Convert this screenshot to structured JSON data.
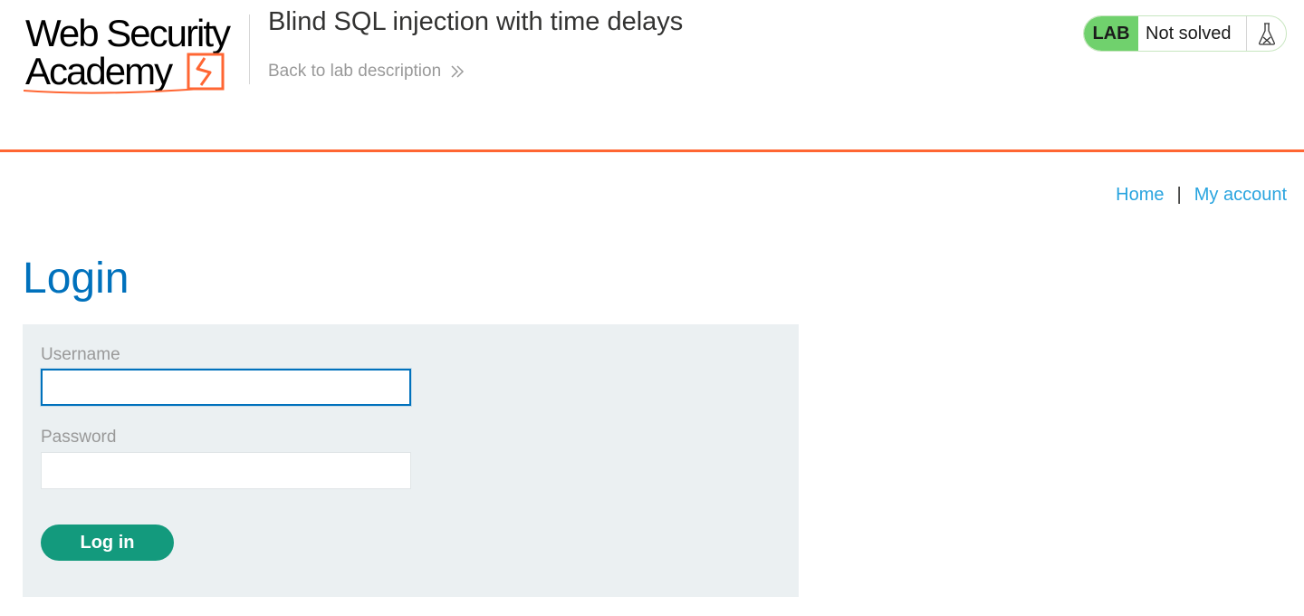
{
  "header": {
    "logo_line1": "Web Security",
    "logo_line2": "Academy",
    "lab_title": "Blind SQL injection with time delays",
    "back_link": "Back to lab description",
    "status": {
      "badge": "LAB",
      "text": "Not solved",
      "icon": "flask-icon"
    }
  },
  "nav": {
    "home": "Home",
    "separator": "|",
    "account": "My account"
  },
  "login": {
    "title": "Login",
    "username_label": "Username",
    "username_value": "",
    "password_label": "Password",
    "password_value": "",
    "submit_label": "Log in"
  },
  "colors": {
    "accent_orange": "#ff6633",
    "title_blue": "#0071bc",
    "link_blue": "#29a4df",
    "button_green": "#139a7d",
    "lab_badge_green": "#70d16d",
    "panel_bg": "#ebf0f2"
  }
}
